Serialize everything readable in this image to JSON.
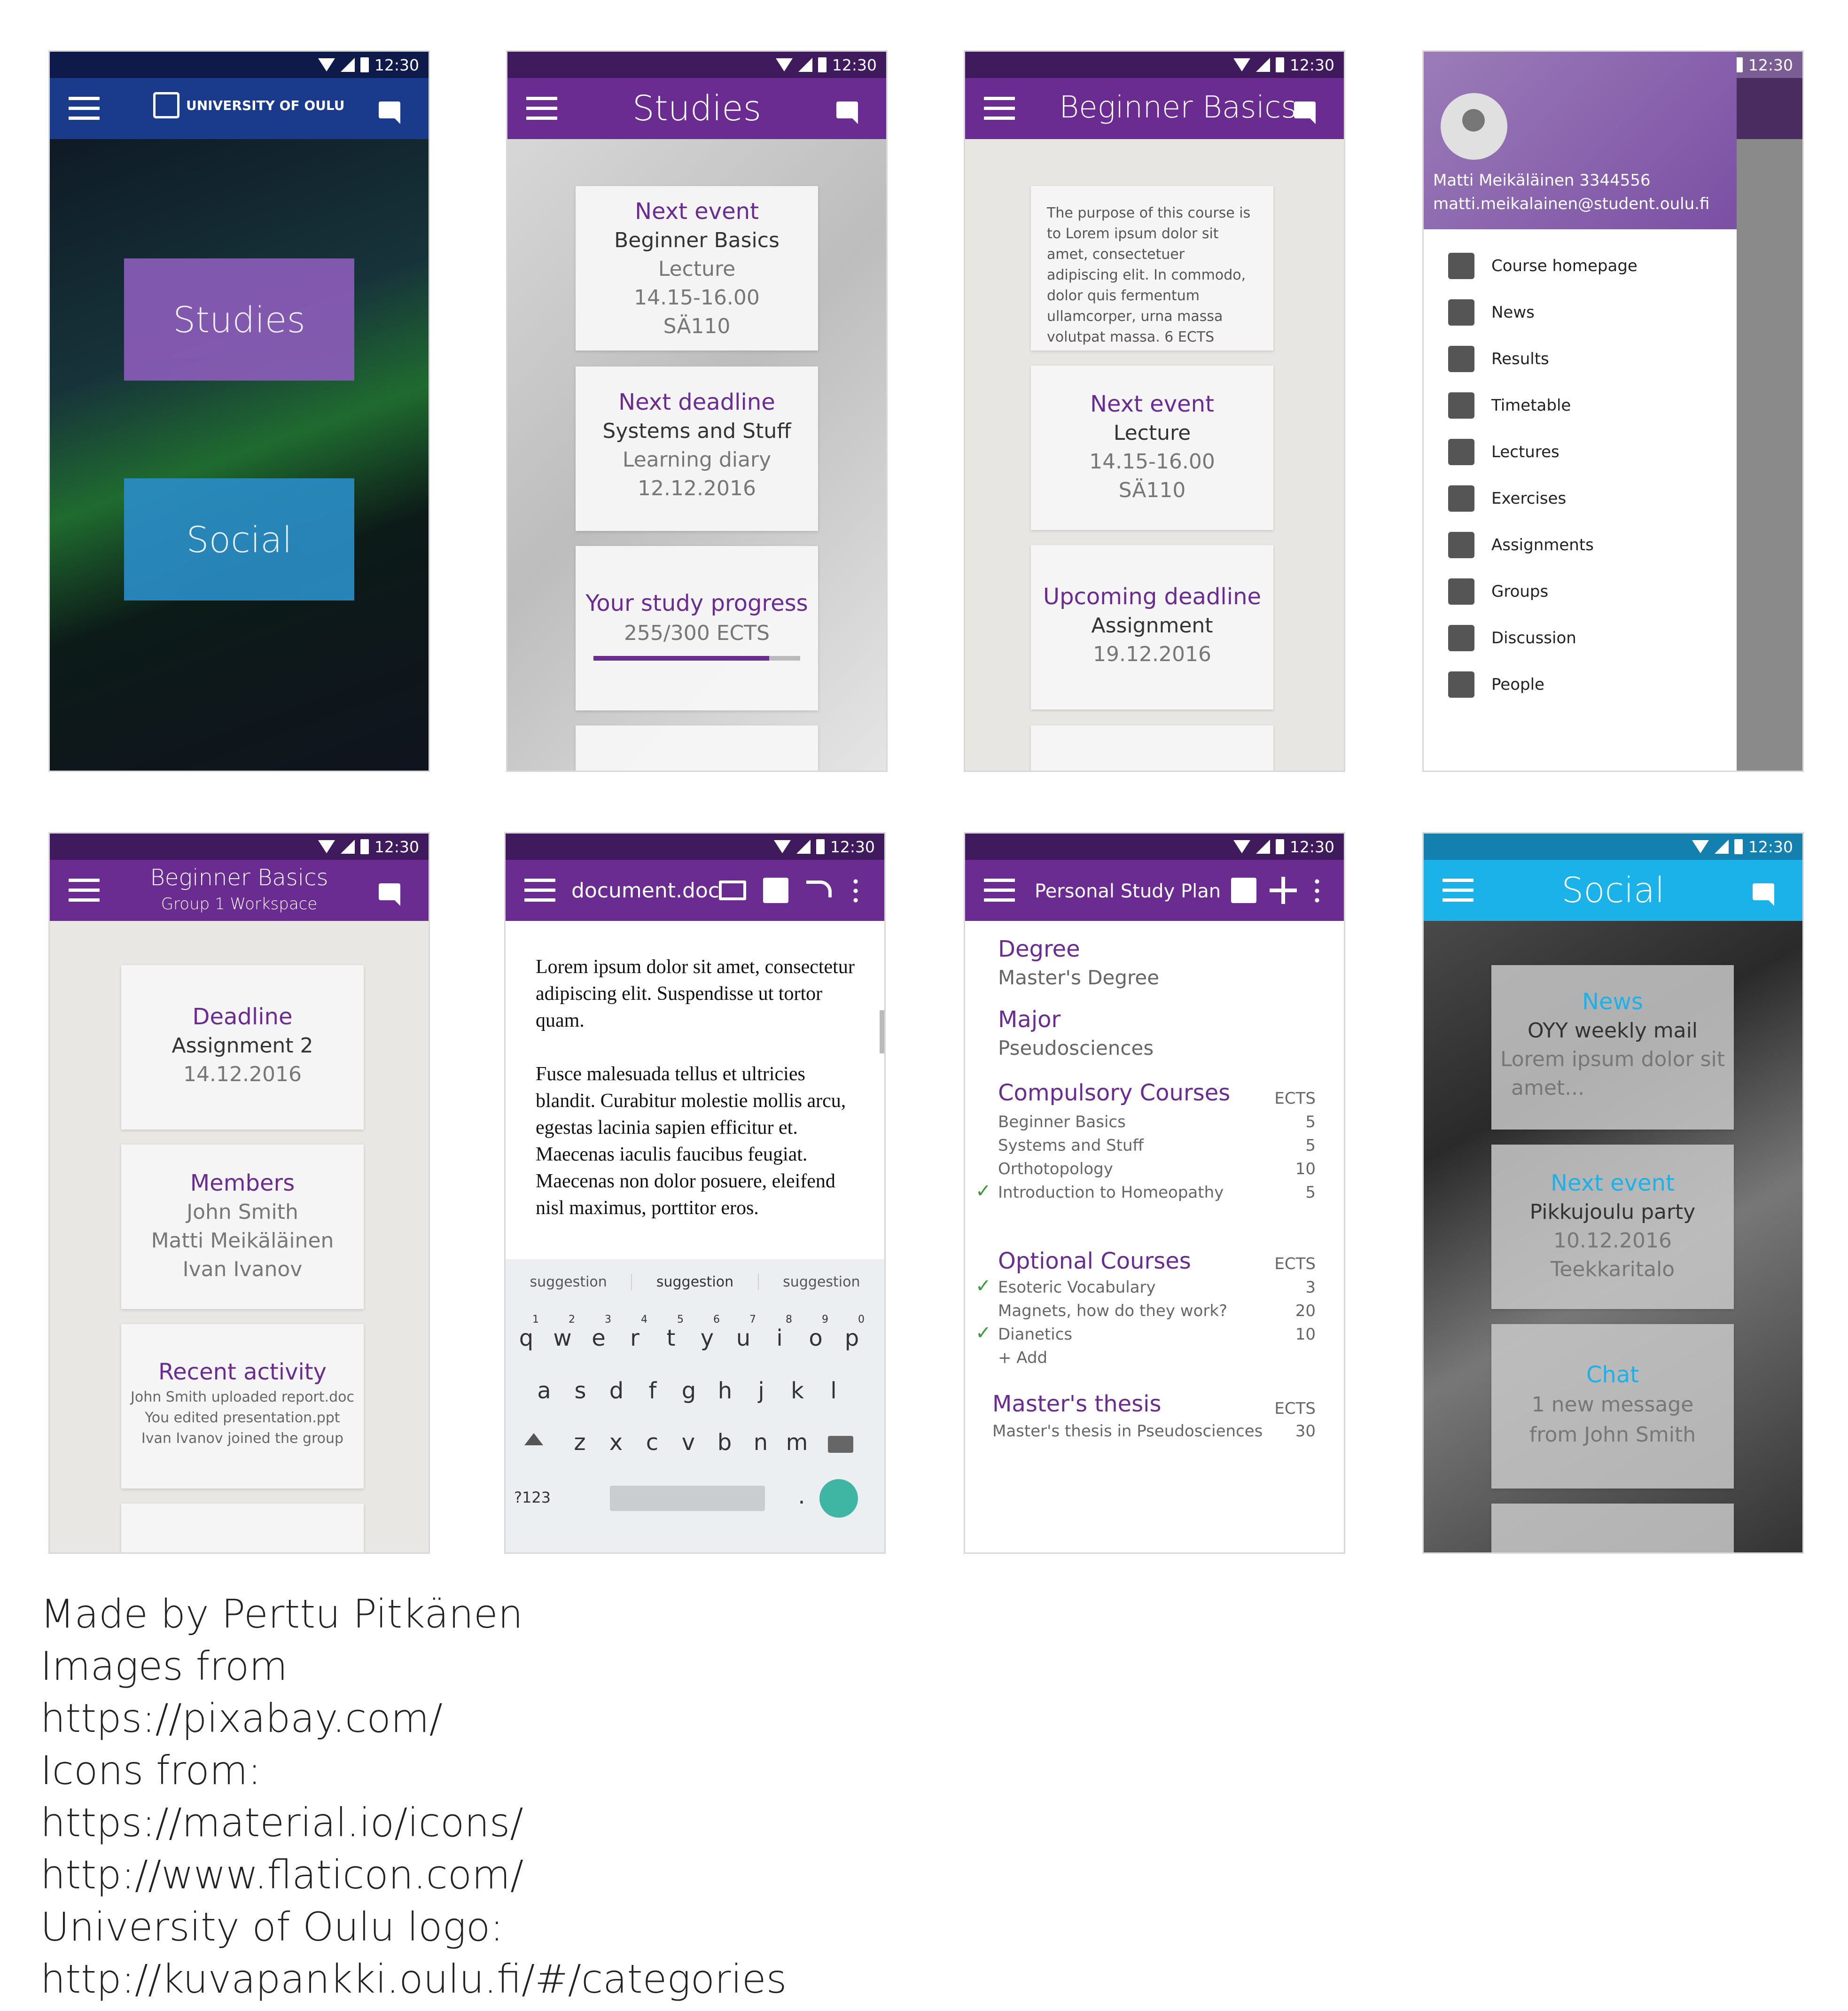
{
  "status_time": "12:30",
  "screen_home": {
    "brand": "UNIVERSITY OF OULU",
    "tiles": [
      "Studies",
      "Social"
    ]
  },
  "screen_studies": {
    "title": "Studies",
    "next_event": {
      "heading": "Next event",
      "course": "Beginner Basics",
      "type": "Lecture",
      "time": "14.15-16.00",
      "room": "SÄ110"
    },
    "next_deadline": {
      "heading": "Next deadline",
      "course": "Systems and Stuff",
      "task": "Learning diary",
      "date": "12.12.2016"
    },
    "progress": {
      "heading": "Your study progress",
      "value_text": "255/300 ECTS",
      "fraction": 0.85
    }
  },
  "screen_course": {
    "title": "Beginner Basics",
    "description": "The purpose of this course is to Lorem ipsum dolor sit amet, consectetuer adipiscing elit. In commodo, dolor quis fermentum ullamcorper, urna massa volutpat massa. 6 ECTS",
    "next_event": {
      "heading": "Next event",
      "type": "Lecture",
      "time": "14.15-16.00",
      "room": "SÄ110"
    },
    "deadline": {
      "heading": "Upcoming deadline",
      "task": "Assignment",
      "date": "19.12.2016"
    }
  },
  "screen_drawer": {
    "user_name": "Matti Meikäläinen 3344556",
    "user_email": "matti.meikalainen@student.oulu.fi",
    "items": [
      "Course homepage",
      "News",
      "Results",
      "Timetable",
      "Lectures",
      "Exercises",
      "Assignments",
      "Groups",
      "Discussion",
      "People"
    ],
    "icons": [
      "home-icon",
      "news-icon",
      "star-icon",
      "calendar-icon",
      "book-icon",
      "pencil-icon",
      "document-icon",
      "group-icon",
      "forum-icon",
      "person-icon"
    ]
  },
  "screen_group": {
    "title": "Beginner Basics",
    "subtitle": "Group 1 Workspace",
    "deadline": {
      "heading": "Deadline",
      "task": "Assignment 2",
      "date": "14.12.2016"
    },
    "members": {
      "heading": "Members",
      "names": [
        "John Smith",
        "Matti Meikäläinen",
        "Ivan Ivanov"
      ]
    },
    "activity": {
      "heading": "Recent activity",
      "lines": [
        "John Smith uploaded report.doc",
        "You edited presentation.ppt",
        "Ivan Ivanov joined the group"
      ]
    }
  },
  "screen_editor": {
    "title": "document.doc",
    "para1": "Lorem ipsum dolor sit amet, consectetur adipiscing elit. Suspendisse ut tortor quam.",
    "para2": "Fusce malesuada tellus et ultricies blandit. Curabitur molestie mollis arcu, egestas lacinia sapien efficitur et. Maecenas iaculis faucibus feugiat. Maecenas non dolor posuere, eleifend nisl maximus, porttitor eros.",
    "suggestions": [
      "suggestion",
      "suggestion",
      "suggestion"
    ],
    "row1": [
      "q",
      "w",
      "e",
      "r",
      "t",
      "y",
      "u",
      "i",
      "o",
      "p"
    ],
    "row1_nums": [
      "1",
      "2",
      "3",
      "4",
      "5",
      "6",
      "7",
      "8",
      "9",
      "0"
    ],
    "row2": [
      "a",
      "s",
      "d",
      "f",
      "g",
      "h",
      "j",
      "k",
      "l"
    ],
    "row3": [
      "z",
      "x",
      "c",
      "v",
      "b",
      "n",
      "m"
    ],
    "sym_key": "?123",
    "comma": ",",
    "period": "."
  },
  "screen_plan": {
    "title": "Personal Study Plan",
    "degree_label": "Degree",
    "degree_value": "Master's Degree",
    "major_label": "Major",
    "major_value": "Pseudosciences",
    "compulsory_label": "Compulsory Courses",
    "ects_label": "ECTS",
    "compulsory": [
      {
        "name": "Beginner Basics",
        "ects": "5",
        "done": false
      },
      {
        "name": "Systems and Stuff",
        "ects": "5",
        "done": false
      },
      {
        "name": "Orthotopology",
        "ects": "10",
        "done": false
      },
      {
        "name": "Introduction to Homeopathy",
        "ects": "5",
        "done": true
      }
    ],
    "optional_label": "Optional Courses",
    "optional": [
      {
        "name": "Esoteric Vocabulary",
        "ects": "3",
        "done": true
      },
      {
        "name": "Magnets, how do they work?",
        "ects": "20",
        "done": false
      },
      {
        "name": "Dianetics",
        "ects": "10",
        "done": true
      }
    ],
    "add_label": "+ Add",
    "thesis_label": "Master's thesis",
    "thesis_value": "Master's thesis in Pseudosciences",
    "thesis_ects": "30"
  },
  "screen_social": {
    "title": "Social",
    "news": {
      "heading": "News",
      "title": "OYY weekly mail",
      "text1": "Lorem ipsum dolor sit",
      "text2": "amet..."
    },
    "event": {
      "heading": "Next event",
      "title": "Pikkujoulu party",
      "date": "10.12.2016",
      "place": "Teekkaritalo"
    },
    "chat": {
      "heading": "Chat",
      "line1": "1 new message",
      "line2": "from John Smith"
    }
  },
  "credits": [
    "Made by Perttu Pitkänen",
    "Images from",
    "https://pixabay.com/",
    "Icons from:",
    "https://material.io/icons/",
    "http://www.flaticon.com/",
    "University of Oulu logo:",
    "http://kuvapankki.oulu.fi/#/categories"
  ],
  "colors": {
    "purple": "#6b2c91",
    "dark_purple": "#3f1a5c",
    "uni_blue": "#1a3a8c",
    "social_blue": "#1ab2e8",
    "check_green": "#3c9a3c"
  }
}
